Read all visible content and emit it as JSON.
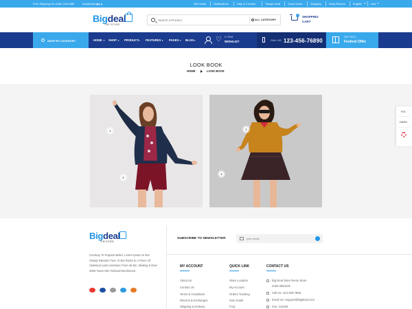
{
  "topbar": {
    "left": [
      "Free Shipping On Order Over $99",
      "Download App"
    ],
    "right": [
      "Gift Cards",
      "Notifications",
      "Help & Contact",
      "Todays Deal",
      "Track Order",
      "Shipping",
      "Easy Returns",
      "English",
      "Usd"
    ]
  },
  "header": {
    "logo_big": "Big",
    "logo_deal": "deal",
    "logo_sub": "THE STORE",
    "search_placeholder": "Search a Product",
    "category_label": "ALL CATEGORY",
    "cart_count": "0",
    "cart_line1": "SHOPPING",
    "cart_line2": "CART"
  },
  "nav": {
    "shop_by_category": "SHOP BY CATEGORY",
    "menu": [
      "HOME",
      "SHOP",
      "PRODUCT",
      "FEATURES",
      "PAGES",
      "BLOG"
    ],
    "wishlist_count": "0 ITEM",
    "wishlist_label": "WISHLIST",
    "call_label": "CALL US",
    "phone": "123-456-76890",
    "gift_line1": "GIFT BOX",
    "gift_line2": "Festivel Offer"
  },
  "page": {
    "title": "LOOK BOOK",
    "breadcrumb": [
      "HOME",
      "LOOK BOOK"
    ]
  },
  "lookbook": {
    "hotspots": [
      "1",
      "2",
      "1",
      "2"
    ]
  },
  "side_widget": {
    "rtl": "RTL",
    "dark": "DARK"
  },
  "footer": {
    "logo_big": "Big",
    "logo_deal": "deal",
    "logo_sub": "THE STORE",
    "description": "Contrary To Popular Belief, Lorem Ipsum Is Not Simply Random Text. It Has Roots In A Piece Of Classical Latin Literature From 45 BC, Making It Over 2000 Years Old. Richard McClintock.",
    "newsletter_label": "SUBSCRIBE TO NEWSLETTER",
    "newsletter_placeholder": "your email",
    "my_account": {
      "title": "MY ACCOUNT",
      "items": [
        "About Us",
        "Contact Us",
        "Terms & Conditions",
        "Returns & Exchanges",
        "Shipping & Delivery"
      ]
    },
    "quick_link": {
      "title": "QUICK LINK",
      "items": [
        "Store Location",
        "My Account",
        "Orders Tracking",
        "Size Guide",
        "FAQ"
      ]
    },
    "contact_us": {
      "title": "CONTACT US",
      "items": [
        "Big Deal Store Demo Store",
        "India-3654125",
        "Call Us: 123-456-7898",
        "Email Us: Support@Bigdeal.Com",
        "Fax: 123456"
      ]
    }
  },
  "colors": {
    "accent_blue": "#3aa9ec",
    "navy": "#1a3b8e"
  }
}
